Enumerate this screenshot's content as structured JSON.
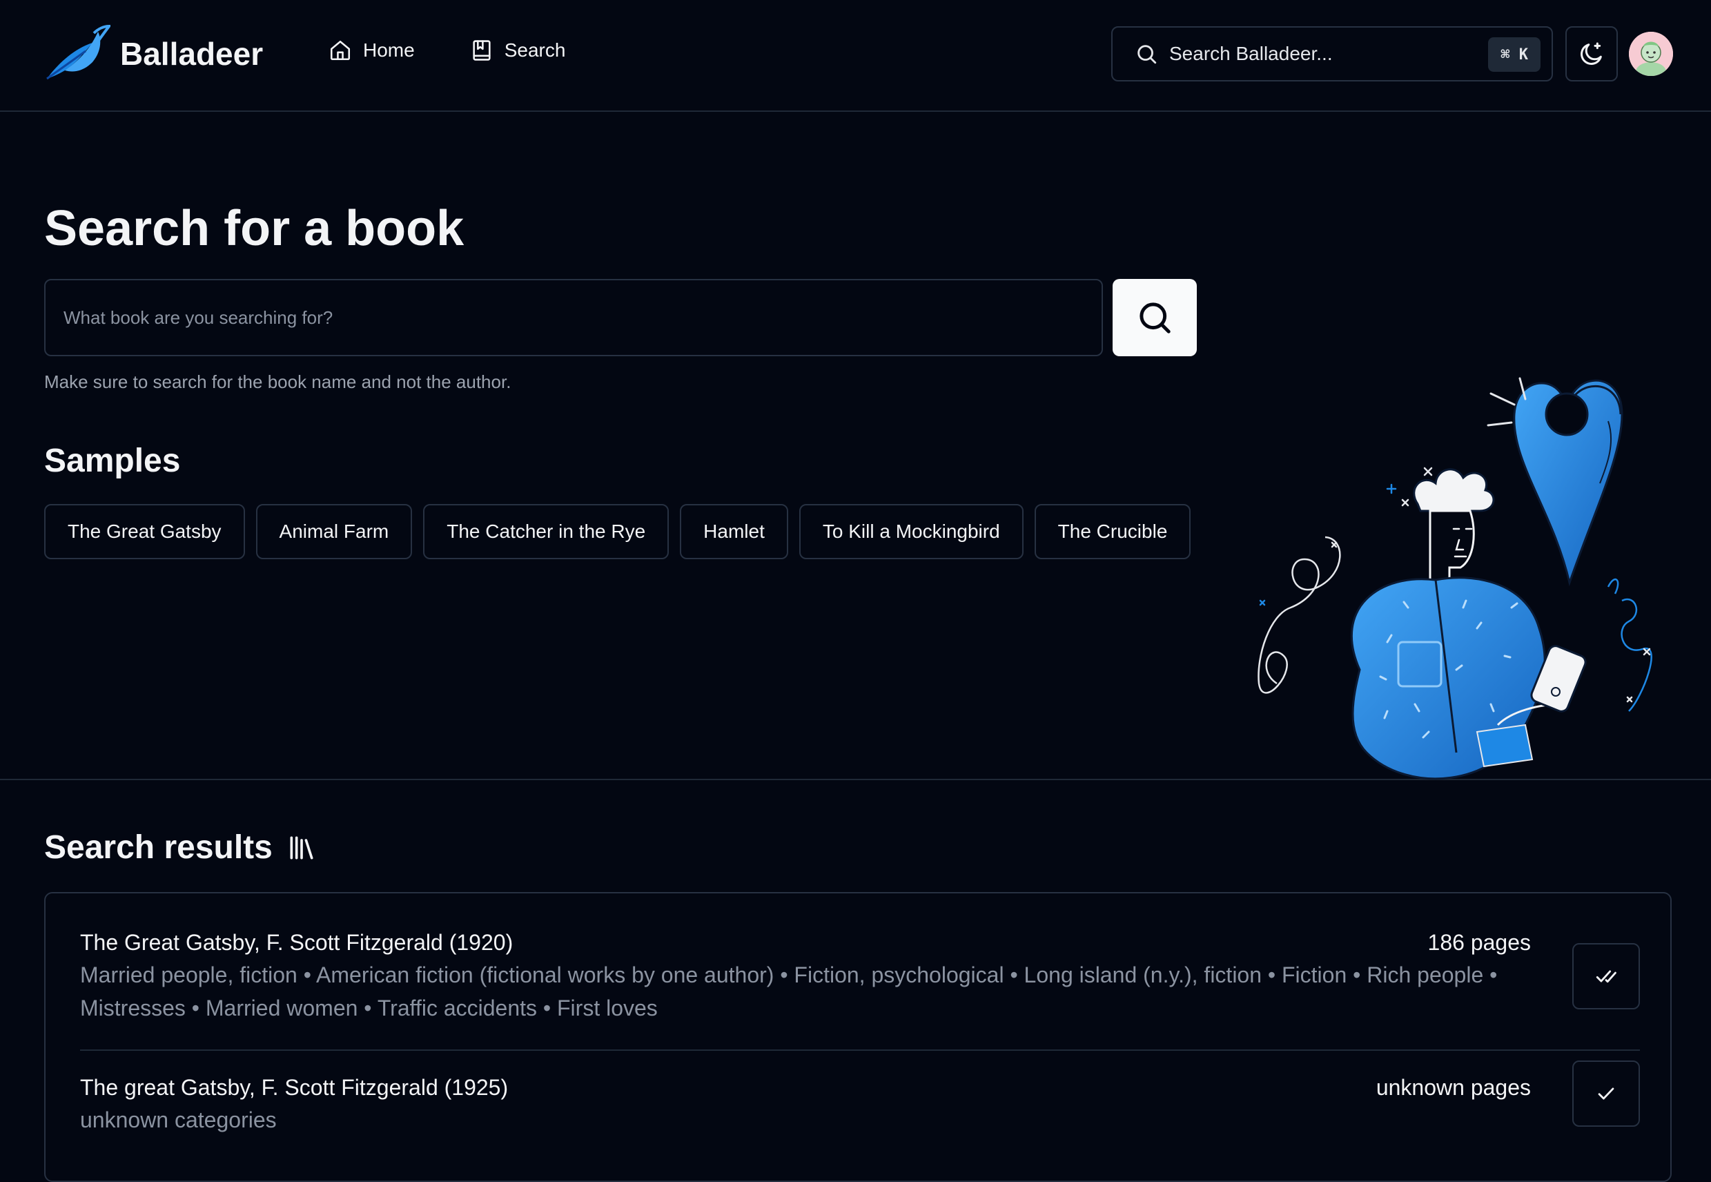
{
  "header": {
    "brand": "Balladeer",
    "nav": [
      {
        "label": "Home",
        "icon": "home-icon"
      },
      {
        "label": "Search",
        "icon": "book-icon"
      }
    ],
    "search_placeholder": "Search Balladeer...",
    "shortcut": "⌘ K",
    "theme_icon": "moon-icon",
    "avatar_icon": "user-avatar"
  },
  "hero": {
    "title": "Search for a book",
    "input_placeholder": "What book are you searching for?",
    "hint": "Make sure to search for the book name and not the author.",
    "samples_title": "Samples",
    "samples": [
      "The Great Gatsby",
      "Animal Farm",
      "The Catcher in the Rye",
      "Hamlet",
      "To Kill a Mockingbird",
      "The Crucible"
    ]
  },
  "results": {
    "title": "Search results",
    "items": [
      {
        "title": "The Great Gatsby, F. Scott Fitzgerald (1920)",
        "pages": "186 pages",
        "categories": "Married people, fiction • American fiction (fictional works by one author) • Fiction, psychological • Long island (n.y.), fiction • Fiction • Rich people • Mistresses • Married women • Traffic accidents • First loves",
        "status_icon": "double-check-icon"
      },
      {
        "title": "The great Gatsby, F. Scott Fitzgerald (1925)",
        "pages": "unknown pages",
        "categories": "unknown categories",
        "status_icon": "check-icon"
      }
    ]
  },
  "colors": {
    "background": "#030712",
    "border": "#273142",
    "accent_blue": "#1e88e5",
    "muted_text": "#8b93a1"
  }
}
